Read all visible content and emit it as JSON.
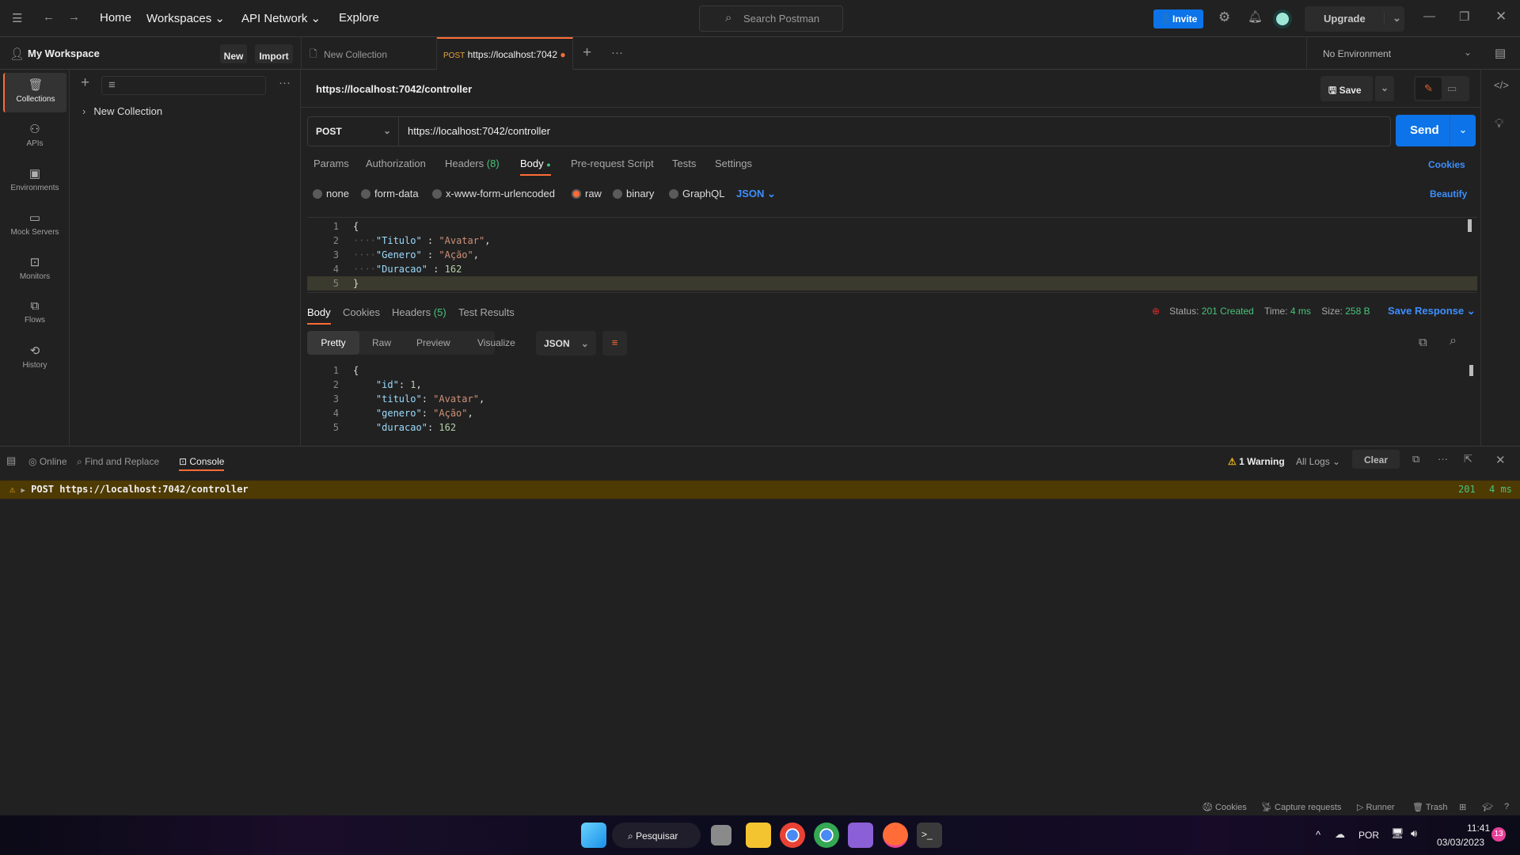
{
  "titlebar": {
    "nav": [
      "Home",
      "Workspaces",
      "API Network",
      "Explore"
    ],
    "search_placeholder": "Search Postman",
    "invite": "Invite",
    "upgrade": "Upgrade"
  },
  "workspace": {
    "name": "My Workspace",
    "new": "New",
    "import": "Import"
  },
  "tabs": [
    {
      "label": "New Collection"
    },
    {
      "method": "POST",
      "label": "https://localhost:7042"
    }
  ],
  "environment": "No Environment",
  "sidebar": {
    "items": [
      {
        "label": "Collections",
        "icon": "trash-bin-icon"
      },
      {
        "label": "APIs",
        "icon": "apis-icon"
      },
      {
        "label": "Environments",
        "icon": "environment-icon"
      },
      {
        "label": "Mock Servers",
        "icon": "server-icon"
      },
      {
        "label": "Monitors",
        "icon": "monitor-icon"
      },
      {
        "label": "Flows",
        "icon": "flows-icon"
      },
      {
        "label": "History",
        "icon": "history-icon"
      }
    ]
  },
  "collections": [
    {
      "name": "New Collection"
    }
  ],
  "request": {
    "title": "https://localhost:7042/controller",
    "save": "Save",
    "method": "POST",
    "url": "https://localhost:7042/controller",
    "send": "Send",
    "tabs": [
      "Params",
      "Authorization",
      "Headers",
      "Body",
      "Pre-request Script",
      "Tests",
      "Settings"
    ],
    "headers_count": "(8)",
    "cookies": "Cookies",
    "body_types": [
      "none",
      "form-data",
      "x-www-form-urlencoded",
      "raw",
      "binary",
      "GraphQL"
    ],
    "selected_body_type": "raw",
    "format": "JSON",
    "beautify": "Beautify",
    "body_lines": [
      [
        "{"
      ],
      [
        "\"Titulo\"",
        "\"Avatar\""
      ],
      [
        "\"Genero\"",
        "\"Ação\""
      ],
      [
        "\"Duracao\"",
        "162"
      ],
      [
        "}"
      ]
    ]
  },
  "response": {
    "tabs": [
      "Body",
      "Cookies",
      "Headers",
      "Test Results"
    ],
    "headers_count": "(5)",
    "status_label": "Status:",
    "status": "201 Created",
    "time_label": "Time:",
    "time": "4 ms",
    "size_label": "Size:",
    "size": "258 B",
    "save_response": "Save Response",
    "views": [
      "Pretty",
      "Raw",
      "Preview",
      "Visualize"
    ],
    "format": "JSON",
    "lines": [
      [
        "\"id\"",
        "1"
      ],
      [
        "\"titulo\"",
        "\"Avatar\""
      ],
      [
        "\"genero\"",
        "\"Ação\""
      ],
      [
        "\"duracao\"",
        "162"
      ]
    ]
  },
  "console": {
    "online": "Online",
    "find_replace": "Find and Replace",
    "console": "Console",
    "warnings": "1 Warning",
    "all_logs": "All Logs",
    "clear": "Clear",
    "log": {
      "text": "POST https://localhost:7042/controller",
      "status": "201",
      "time": "4 ms"
    }
  },
  "footer": {
    "cookies": "Cookies",
    "capture": "Capture requests",
    "runner": "Runner",
    "trash": "Trash"
  },
  "taskbar": {
    "search": "Pesquisar",
    "lang": "POR",
    "time": "11:41",
    "date": "03/03/2023",
    "notifications": "13"
  },
  "colors": {
    "accent": "#ff6c37",
    "send": "#0c74e8",
    "success": "#49c37b",
    "link": "#3d8fff",
    "warning_bg": "#4e3a03"
  }
}
